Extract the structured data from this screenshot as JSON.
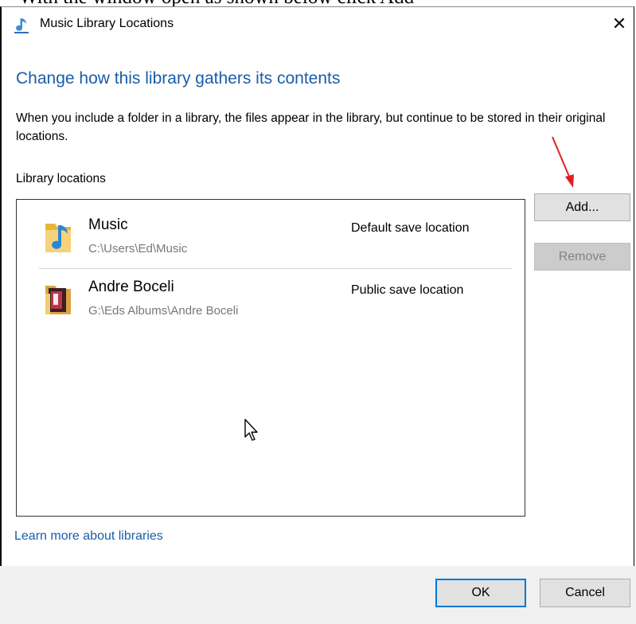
{
  "caption": "With the window open as shown below click Add",
  "dialog": {
    "title": "Music Library Locations",
    "close_glyph": "✕",
    "heading": "Change how this library gathers its contents",
    "description": "When you include a folder in a library, the files appear in the library, but continue to be stored in their original locations.",
    "locations_label": "Library locations",
    "locations": [
      {
        "name": "Music",
        "path": "C:\\Users\\Ed\\Music",
        "status": "Default save location",
        "icon": "music-folder-icon"
      },
      {
        "name": "Andre Boceli",
        "path": "G:\\Eds Albums\\Andre Boceli",
        "status": "Public save location",
        "icon": "album-folder-icon"
      }
    ],
    "buttons": {
      "add": "Add...",
      "remove": "Remove",
      "ok": "OK",
      "cancel": "Cancel"
    },
    "learn_more": "Learn more about libraries"
  },
  "colors": {
    "heading_blue": "#1a5da8",
    "link_blue": "#1a5da8",
    "annotation_arrow": "#e02020",
    "ok_border": "#0078d7",
    "footer_bg": "#f0f0f0"
  }
}
